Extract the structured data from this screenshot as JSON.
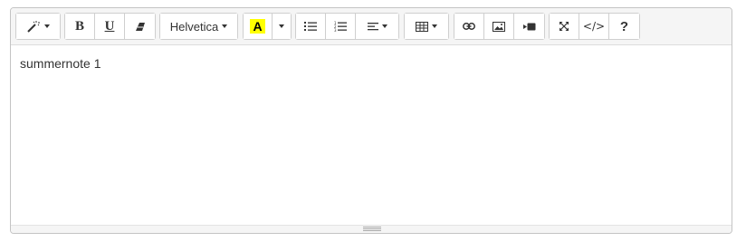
{
  "toolbar": {
    "style_icon": "magic-wand-icon",
    "bold_label": "B",
    "underline_label": "U",
    "clear_icon": "eraser-icon",
    "font_name": "Helvetica",
    "color_label": "A",
    "color_highlight": "#ffff00",
    "list_icons": [
      "unordered-list-icon",
      "ordered-list-icon",
      "align-paragraph-icon"
    ],
    "table_icon": "table-icon",
    "insert_icons": [
      "link-icon",
      "picture-icon",
      "video-icon"
    ],
    "view_icons": [
      "fullscreen-icon",
      "code-view-icon",
      "help-icon"
    ],
    "codeview_label": "</>",
    "help_label": "?"
  },
  "content": {
    "text": "summernote 1"
  }
}
